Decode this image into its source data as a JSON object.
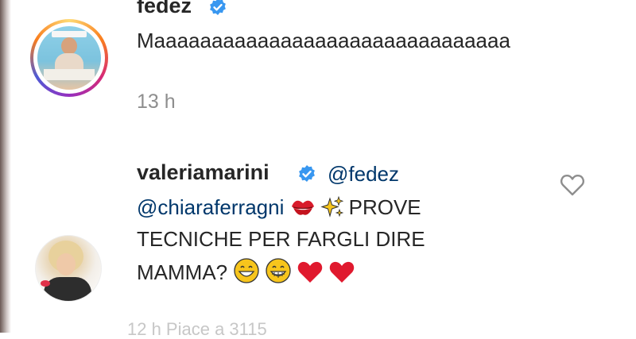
{
  "comments": [
    {
      "username": "fedez",
      "text": "Maaaaaaaaaaaaaaaaaaaaaaaaaaaaaaa",
      "time": "13 h"
    },
    {
      "username": "valeriamarini",
      "mention1": "@fedez",
      "mention2": "@chiaraferragni",
      "text_part1": "PROVE",
      "text_part2": "TECNICHE PER FARGLI DIRE",
      "text_part3": "MAMMA?",
      "emojis": [
        "kiss-mark-icon",
        "sparkles-icon",
        "grinning-face-icon",
        "beaming-face-icon",
        "red-heart-icon",
        "red-heart-icon"
      ],
      "time_partial": "12 h     Piace a     3115"
    }
  ],
  "colors": {
    "verified": "#3897f0",
    "mention": "#00376b",
    "heart": "#e0245e",
    "muted": "#8e8e8e"
  }
}
